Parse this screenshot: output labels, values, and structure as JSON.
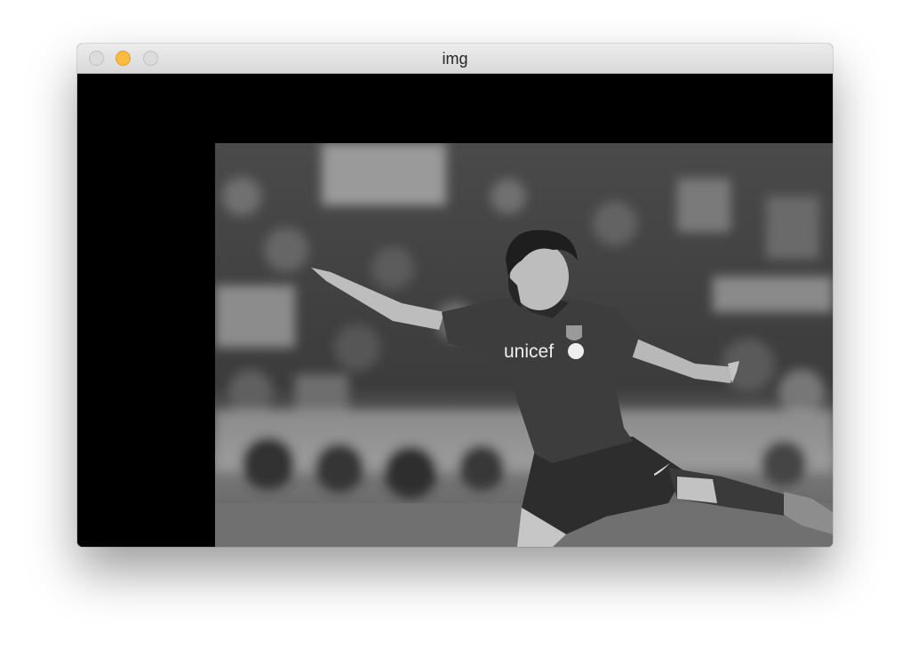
{
  "window": {
    "title": "img",
    "traffic_lights": {
      "close_color": "#dcdcdc",
      "minimize_color": "#fdbc40",
      "maximize_color": "#dcdcdc"
    }
  },
  "image": {
    "description_icon": "grayscale-photo",
    "jersey_text": "unicef"
  }
}
